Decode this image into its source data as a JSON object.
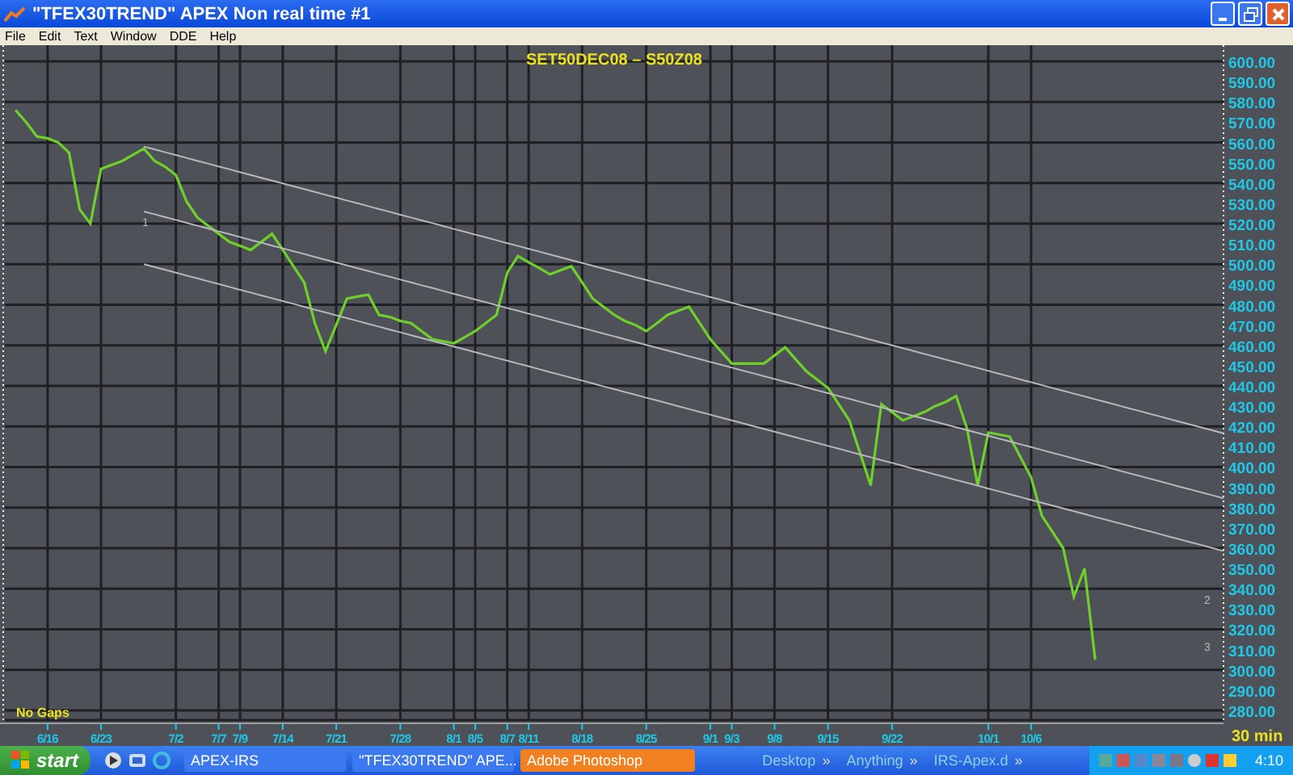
{
  "window": {
    "title": "\"TFEX30TREND\" APEX Non real time #1"
  },
  "menu": [
    "File",
    "Edit",
    "Text",
    "Window",
    "DDE",
    "Help"
  ],
  "chart": {
    "gaps_label": "No Gaps",
    "interval": "30 min",
    "chart_data": {
      "type": "line",
      "title": "SET50DEC08  –  S50Z08",
      "categories": [
        null,
        null,
        null,
        "6/16",
        null,
        null,
        null,
        null,
        "6/23",
        null,
        null,
        null,
        null,
        null,
        null,
        "7/2",
        null,
        null,
        null,
        "7/7",
        null,
        "7/9",
        null,
        null,
        null,
        "7/14",
        null,
        null,
        null,
        null,
        "7/21",
        null,
        null,
        null,
        null,
        null,
        "7/28",
        null,
        null,
        null,
        null,
        "8/1",
        null,
        "8/5",
        null,
        null,
        "8/7",
        null,
        "8/11",
        null,
        null,
        null,
        null,
        "8/18",
        null,
        null,
        null,
        null,
        null,
        "8/25",
        null,
        null,
        null,
        null,
        null,
        "9/1",
        null,
        "9/3",
        null,
        null,
        null,
        "9/8",
        null,
        null,
        null,
        null,
        "9/15",
        null,
        null,
        null,
        null,
        null,
        "9/22",
        null,
        null,
        null,
        null,
        null,
        null,
        null,
        null,
        "10/1",
        null,
        null,
        null,
        "10/6",
        null,
        null,
        null,
        null,
        null,
        null,
        null,
        null,
        null,
        null,
        null,
        null,
        null,
        null,
        null,
        null,
        null,
        null
      ],
      "series": [
        {
          "color": "#6fd02a",
          "values": [
            576,
            570,
            563,
            562,
            560,
            555,
            527,
            520,
            547,
            549,
            551,
            554,
            557,
            551,
            548,
            544,
            531,
            523,
            519,
            515,
            511,
            509,
            507,
            511,
            515,
            507,
            499,
            491,
            471,
            457,
            470,
            483,
            484,
            485,
            475,
            474,
            472,
            471,
            467,
            463,
            462,
            461,
            464,
            467,
            471,
            475,
            496,
            504,
            501,
            498,
            495,
            497,
            499,
            491,
            483,
            479,
            475,
            472,
            470,
            467,
            471,
            475,
            477,
            479,
            471,
            463,
            457,
            451,
            451,
            451,
            451,
            455,
            459,
            453,
            447,
            443,
            439,
            431,
            423,
            407,
            391,
            431,
            427,
            423,
            425,
            427,
            430,
            432,
            435,
            419,
            391,
            417,
            416,
            415,
            405,
            395,
            376,
            368,
            360,
            336,
            350,
            305,
            null,
            null,
            null,
            null,
            null,
            null,
            null,
            null,
            null,
            null,
            null,
            null
          ]
        },
        {
          "color": "#b8b8bc",
          "values": [
            null,
            null,
            null,
            null,
            null,
            null,
            null,
            null,
            null,
            null,
            null,
            null,
            558,
            556.6,
            555.2,
            553.8,
            552.4,
            551,
            549.6,
            548.2,
            546.8,
            545.4,
            544,
            542.6,
            541.2,
            539.8,
            538.4,
            537,
            535.6,
            534.2,
            532.8,
            531.4,
            530,
            528.6,
            527.2,
            525.8,
            524.4,
            523,
            521.6,
            520.2,
            518.8,
            517.4,
            516,
            514.6,
            513.2,
            511.8,
            510.4,
            509,
            507.6,
            506.2,
            504.8,
            503.4,
            502,
            500.6,
            499.2,
            497.8,
            496.4,
            495,
            493.6,
            492.2,
            490.8,
            489.4,
            488,
            486.6,
            485.2,
            483.8,
            482.4,
            481,
            479.6,
            478.2,
            476.8,
            475.4,
            474,
            472.6,
            471.2,
            469.8,
            468.4,
            467,
            465.6,
            464.2,
            462.8,
            461.4,
            460,
            458.6,
            457.2,
            455.8,
            454.4,
            453,
            451.6,
            450.2,
            448.8,
            447.4,
            446,
            444.6,
            443.2,
            441.8,
            440.4,
            439,
            437.6,
            436.2,
            434.8,
            433.4,
            432,
            430.6,
            429.2,
            427.8,
            426.4,
            425,
            423.6,
            422.2,
            420.8,
            419.4,
            418,
            416.6
          ]
        },
        {
          "color": "#b8b8bc",
          "values": [
            null,
            null,
            null,
            null,
            null,
            null,
            null,
            null,
            null,
            null,
            null,
            null,
            526,
            524.6,
            523.2,
            521.8,
            520.4,
            519,
            517.6,
            516.2,
            514.8,
            513.4,
            512,
            510.6,
            509.2,
            507.8,
            506.4,
            505,
            503.6,
            502.2,
            500.8,
            499.4,
            498,
            496.6,
            495.2,
            493.8,
            492.4,
            491,
            489.6,
            488.2,
            486.8,
            485.4,
            484,
            482.6,
            481.2,
            479.8,
            478.4,
            477,
            475.6,
            474.2,
            472.8,
            471.4,
            470,
            468.6,
            467.2,
            465.8,
            464.4,
            463,
            461.6,
            460.2,
            458.8,
            457.4,
            456,
            454.6,
            453.2,
            451.8,
            450.4,
            449,
            447.6,
            446.2,
            444.8,
            443.4,
            442,
            440.6,
            439.2,
            437.8,
            436.4,
            435,
            433.6,
            432.2,
            430.8,
            429.4,
            428,
            426.6,
            425.2,
            423.8,
            422.4,
            421,
            419.6,
            418.2,
            416.8,
            415.4,
            414,
            412.6,
            411.2,
            409.8,
            408.4,
            407,
            405.6,
            404.2,
            402.8,
            401.4,
            400,
            398.6,
            397.2,
            395.8,
            394.4,
            393,
            391.6,
            390.2,
            388.8,
            387.4,
            386,
            384.6
          ]
        },
        {
          "color": "#b8b8bc",
          "values": [
            null,
            null,
            null,
            null,
            null,
            null,
            null,
            null,
            null,
            null,
            null,
            null,
            500,
            498.6,
            497.2,
            495.8,
            494.4,
            493,
            491.6,
            490.2,
            488.8,
            487.4,
            486,
            484.6,
            483.2,
            481.8,
            480.4,
            479,
            477.6,
            476.2,
            474.8,
            473.4,
            472,
            470.6,
            469.2,
            467.8,
            466.4,
            465,
            463.6,
            462.2,
            460.8,
            459.4,
            458,
            456.6,
            455.2,
            453.8,
            452.4,
            451,
            449.6,
            448.2,
            446.8,
            445.4,
            444,
            442.6,
            441.2,
            439.8,
            438.4,
            437,
            435.6,
            434.2,
            432.8,
            431.4,
            430,
            428.6,
            427.2,
            425.8,
            424.4,
            423,
            421.6,
            420.2,
            418.8,
            417.4,
            416,
            414.6,
            413.2,
            411.8,
            410.4,
            409,
            407.6,
            406.2,
            404.8,
            403.4,
            402,
            400.6,
            399.2,
            397.8,
            396.4,
            395,
            393.6,
            392.2,
            390.8,
            389.4,
            388,
            386.6,
            385.2,
            383.8,
            382.4,
            381,
            379.6,
            378.2,
            376.8,
            375.4,
            374,
            372.6,
            371.2,
            369.8,
            368.4,
            367,
            365.6,
            364.2,
            362.8,
            361.4,
            360,
            358.6
          ]
        }
      ],
      "ylim": [
        275,
        605
      ],
      "grid": true,
      "yticks": [
        {
          "value": 600,
          "label": "600.00"
        },
        {
          "value": 590,
          "label": "590.00"
        },
        {
          "value": 580,
          "label": "580.00"
        },
        {
          "value": 570,
          "label": "570.00"
        },
        {
          "value": 560,
          "label": "560.00"
        },
        {
          "value": 550,
          "label": "550.00"
        },
        {
          "value": 540,
          "label": "540.00"
        },
        {
          "value": 530,
          "label": "530.00"
        },
        {
          "value": 520,
          "label": "520.00"
        },
        {
          "value": 510,
          "label": "510.00"
        },
        {
          "value": 500,
          "label": "500.00"
        },
        {
          "value": 490,
          "label": "490.00"
        },
        {
          "value": 480,
          "label": "480.00"
        },
        {
          "value": 470,
          "label": "470.00"
        },
        {
          "value": 460,
          "label": "460.00"
        },
        {
          "value": 450,
          "label": "450.00"
        },
        {
          "value": 440,
          "label": "440.00"
        },
        {
          "value": 430,
          "label": "430.00"
        },
        {
          "value": 420,
          "label": "420.00"
        },
        {
          "value": 410,
          "label": "410.00"
        },
        {
          "value": 400,
          "label": "400.00"
        },
        {
          "value": 390,
          "label": "390.00"
        },
        {
          "value": 380,
          "label": "380.00"
        },
        {
          "value": 370,
          "label": "370.00"
        },
        {
          "value": 360,
          "label": "360.00"
        },
        {
          "value": 350,
          "label": "350.00"
        },
        {
          "value": 340,
          "label": "340.00"
        },
        {
          "value": 330,
          "label": "330.00"
        },
        {
          "value": 320,
          "label": "320.00"
        },
        {
          "value": 310,
          "label": "310.00"
        },
        {
          "value": 300,
          "label": "300.00"
        },
        {
          "value": 290,
          "label": "290.00"
        },
        {
          "value": 280,
          "label": "280.00"
        }
      ],
      "annotations": [
        "1",
        "2",
        "3"
      ]
    }
  },
  "taskbar": {
    "start": "start",
    "tasks": [
      {
        "label": "APEX-IRS",
        "selected": false
      },
      {
        "label": "\"TFEX30TREND\" APE...",
        "selected": false
      },
      {
        "label": "Adobe Photoshop",
        "selected": true
      }
    ],
    "toolbars": [
      "Desktop",
      "Anything",
      "IRS-Apex.d"
    ],
    "toolbar_chevron": "»",
    "clock": "4:10"
  }
}
